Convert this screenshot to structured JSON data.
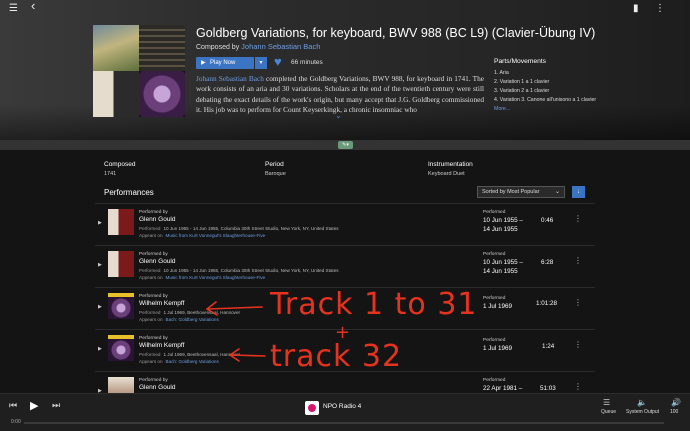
{
  "topbar": {
    "menu_icon": "☰",
    "back_icon": "‹",
    "bookmark_icon": "▮",
    "more_icon": "⋮"
  },
  "work": {
    "title": "Goldberg Variations, for keyboard, BWV 988 (BC L9) (Clavier-Übung IV)",
    "composed_by_label": "Composed by",
    "composer": "Johann Sebastian Bach",
    "play_label": "Play Now",
    "duration": "66 minutes",
    "description_link": "Johann Sebastian Bach",
    "description_text": " completed the Goldberg Variations, BWV 988, for keyboard in 1741. The work consists of an aria and 30 variations. Scholars at the end of the twentieth century were still debating the exact details of the work's origin, but many accept that J.G. Goldberg commissioned it. His job was to perform for Count Keyserkingk, a chronic insomniac who"
  },
  "parts": {
    "heading": "Parts/Movements",
    "items": [
      "1. Aria",
      "2. Variation 1 a 1 clavier",
      "3. Variation 2 a 1 clavier",
      "4. Variation 3. Canone all'unisono a 1 clavier"
    ],
    "more": "More..."
  },
  "meta": {
    "composed_label": "Composed",
    "composed_value": "1741",
    "period_label": "Period",
    "period_value": "Baroque",
    "instr_label": "Instrumentation",
    "instr_value": "Keyboard Duet"
  },
  "performances": {
    "heading": "Performances",
    "sort": "Sorted by Most Popular",
    "rows": [
      {
        "performed_by": "Performed by",
        "performer": "Glenn Gould",
        "details_label": "Performed",
        "details": "10 Jun 1955 - 14 Jun 1955, Columbia 30th Street Studio, New York, NY, United States",
        "appears_label": "Appears on",
        "album": "Music from Kurt Vonnegut's Slaughterhouse-Five",
        "performed_label": "Performed",
        "date_1": "10 Jun 1955 –",
        "date_2": "14 Jun 1955",
        "duration": "0:46"
      },
      {
        "performed_by": "Performed by",
        "performer": "Glenn Gould",
        "details_label": "Performed",
        "details": "10 Jun 1955 - 14 Jun 1955, Columbia 30th Street Studio, New York, NY, United States",
        "appears_label": "Appears on",
        "album": "Music from Kurt Vonnegut's Slaughterhouse-Five",
        "performed_label": "Performed",
        "date_1": "10 Jun 1955 –",
        "date_2": "14 Jun 1955",
        "duration": "6:28"
      },
      {
        "performed_by": "Performed by",
        "performer": "Wilhelm Kempff",
        "details_label": "Performed",
        "details": "1 Jul 1969, Beethovensaal, Hannover",
        "appears_label": "Appears on",
        "album": "Bach: Goldberg Variations",
        "performed_label": "Performed",
        "date_1": "1 Jul 1969",
        "date_2": "",
        "duration": "1:01:28"
      },
      {
        "performed_by": "Performed by",
        "performer": "Wilhelm Kempff",
        "details_label": "Performed",
        "details": "1 Jul 1969, Beethovensaal, Hannover",
        "appears_label": "Appears on",
        "album": "Bach: Goldberg Variations",
        "performed_label": "Performed",
        "date_1": "1 Jul 1969",
        "date_2": "",
        "duration": "1:24"
      },
      {
        "performed_by": "Performed by",
        "performer": "Glenn Gould",
        "details_label": "",
        "details": "",
        "appears_label": "",
        "album": "",
        "performed_label": "Performed",
        "date_1": "22 Apr 1981 –",
        "date_2": "",
        "duration": "51:03"
      }
    ]
  },
  "annotation": {
    "line1": "Track 1 to 31",
    "line2": "+",
    "line3": "track 32",
    "color": "#e6331f"
  },
  "player": {
    "station": "NPO Radio 4",
    "time": "0:00",
    "queue_label": "Queue",
    "output_label": "System Output",
    "volume": "100"
  }
}
